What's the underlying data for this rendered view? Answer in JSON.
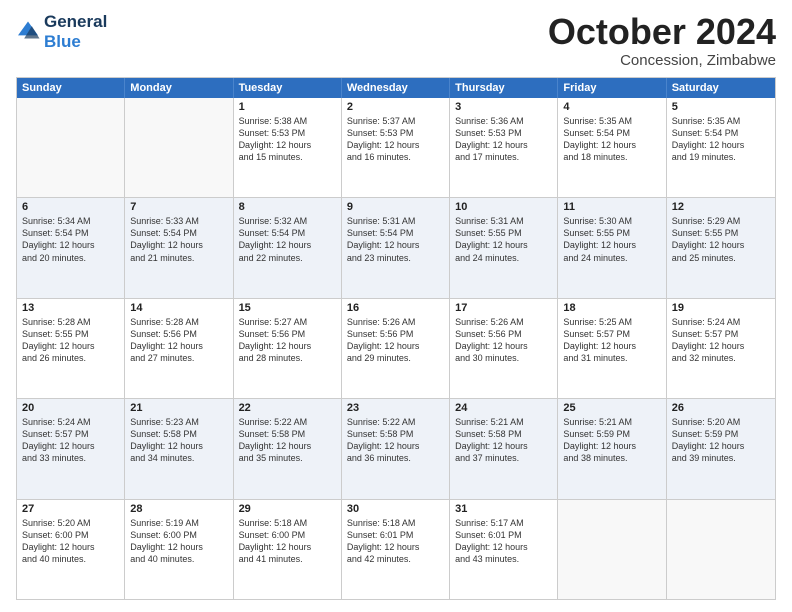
{
  "header": {
    "logo_line1": "General",
    "logo_line2": "Blue",
    "month": "October 2024",
    "location": "Concession, Zimbabwe"
  },
  "days": [
    "Sunday",
    "Monday",
    "Tuesday",
    "Wednesday",
    "Thursday",
    "Friday",
    "Saturday"
  ],
  "weeks": [
    [
      {
        "day": "",
        "lines": []
      },
      {
        "day": "",
        "lines": []
      },
      {
        "day": "1",
        "lines": [
          "Sunrise: 5:38 AM",
          "Sunset: 5:53 PM",
          "Daylight: 12 hours",
          "and 15 minutes."
        ]
      },
      {
        "day": "2",
        "lines": [
          "Sunrise: 5:37 AM",
          "Sunset: 5:53 PM",
          "Daylight: 12 hours",
          "and 16 minutes."
        ]
      },
      {
        "day": "3",
        "lines": [
          "Sunrise: 5:36 AM",
          "Sunset: 5:53 PM",
          "Daylight: 12 hours",
          "and 17 minutes."
        ]
      },
      {
        "day": "4",
        "lines": [
          "Sunrise: 5:35 AM",
          "Sunset: 5:54 PM",
          "Daylight: 12 hours",
          "and 18 minutes."
        ]
      },
      {
        "day": "5",
        "lines": [
          "Sunrise: 5:35 AM",
          "Sunset: 5:54 PM",
          "Daylight: 12 hours",
          "and 19 minutes."
        ]
      }
    ],
    [
      {
        "day": "6",
        "lines": [
          "Sunrise: 5:34 AM",
          "Sunset: 5:54 PM",
          "Daylight: 12 hours",
          "and 20 minutes."
        ]
      },
      {
        "day": "7",
        "lines": [
          "Sunrise: 5:33 AM",
          "Sunset: 5:54 PM",
          "Daylight: 12 hours",
          "and 21 minutes."
        ]
      },
      {
        "day": "8",
        "lines": [
          "Sunrise: 5:32 AM",
          "Sunset: 5:54 PM",
          "Daylight: 12 hours",
          "and 22 minutes."
        ]
      },
      {
        "day": "9",
        "lines": [
          "Sunrise: 5:31 AM",
          "Sunset: 5:54 PM",
          "Daylight: 12 hours",
          "and 23 minutes."
        ]
      },
      {
        "day": "10",
        "lines": [
          "Sunrise: 5:31 AM",
          "Sunset: 5:55 PM",
          "Daylight: 12 hours",
          "and 24 minutes."
        ]
      },
      {
        "day": "11",
        "lines": [
          "Sunrise: 5:30 AM",
          "Sunset: 5:55 PM",
          "Daylight: 12 hours",
          "and 24 minutes."
        ]
      },
      {
        "day": "12",
        "lines": [
          "Sunrise: 5:29 AM",
          "Sunset: 5:55 PM",
          "Daylight: 12 hours",
          "and 25 minutes."
        ]
      }
    ],
    [
      {
        "day": "13",
        "lines": [
          "Sunrise: 5:28 AM",
          "Sunset: 5:55 PM",
          "Daylight: 12 hours",
          "and 26 minutes."
        ]
      },
      {
        "day": "14",
        "lines": [
          "Sunrise: 5:28 AM",
          "Sunset: 5:56 PM",
          "Daylight: 12 hours",
          "and 27 minutes."
        ]
      },
      {
        "day": "15",
        "lines": [
          "Sunrise: 5:27 AM",
          "Sunset: 5:56 PM",
          "Daylight: 12 hours",
          "and 28 minutes."
        ]
      },
      {
        "day": "16",
        "lines": [
          "Sunrise: 5:26 AM",
          "Sunset: 5:56 PM",
          "Daylight: 12 hours",
          "and 29 minutes."
        ]
      },
      {
        "day": "17",
        "lines": [
          "Sunrise: 5:26 AM",
          "Sunset: 5:56 PM",
          "Daylight: 12 hours",
          "and 30 minutes."
        ]
      },
      {
        "day": "18",
        "lines": [
          "Sunrise: 5:25 AM",
          "Sunset: 5:57 PM",
          "Daylight: 12 hours",
          "and 31 minutes."
        ]
      },
      {
        "day": "19",
        "lines": [
          "Sunrise: 5:24 AM",
          "Sunset: 5:57 PM",
          "Daylight: 12 hours",
          "and 32 minutes."
        ]
      }
    ],
    [
      {
        "day": "20",
        "lines": [
          "Sunrise: 5:24 AM",
          "Sunset: 5:57 PM",
          "Daylight: 12 hours",
          "and 33 minutes."
        ]
      },
      {
        "day": "21",
        "lines": [
          "Sunrise: 5:23 AM",
          "Sunset: 5:58 PM",
          "Daylight: 12 hours",
          "and 34 minutes."
        ]
      },
      {
        "day": "22",
        "lines": [
          "Sunrise: 5:22 AM",
          "Sunset: 5:58 PM",
          "Daylight: 12 hours",
          "and 35 minutes."
        ]
      },
      {
        "day": "23",
        "lines": [
          "Sunrise: 5:22 AM",
          "Sunset: 5:58 PM",
          "Daylight: 12 hours",
          "and 36 minutes."
        ]
      },
      {
        "day": "24",
        "lines": [
          "Sunrise: 5:21 AM",
          "Sunset: 5:58 PM",
          "Daylight: 12 hours",
          "and 37 minutes."
        ]
      },
      {
        "day": "25",
        "lines": [
          "Sunrise: 5:21 AM",
          "Sunset: 5:59 PM",
          "Daylight: 12 hours",
          "and 38 minutes."
        ]
      },
      {
        "day": "26",
        "lines": [
          "Sunrise: 5:20 AM",
          "Sunset: 5:59 PM",
          "Daylight: 12 hours",
          "and 39 minutes."
        ]
      }
    ],
    [
      {
        "day": "27",
        "lines": [
          "Sunrise: 5:20 AM",
          "Sunset: 6:00 PM",
          "Daylight: 12 hours",
          "and 40 minutes."
        ]
      },
      {
        "day": "28",
        "lines": [
          "Sunrise: 5:19 AM",
          "Sunset: 6:00 PM",
          "Daylight: 12 hours",
          "and 40 minutes."
        ]
      },
      {
        "day": "29",
        "lines": [
          "Sunrise: 5:18 AM",
          "Sunset: 6:00 PM",
          "Daylight: 12 hours",
          "and 41 minutes."
        ]
      },
      {
        "day": "30",
        "lines": [
          "Sunrise: 5:18 AM",
          "Sunset: 6:01 PM",
          "Daylight: 12 hours",
          "and 42 minutes."
        ]
      },
      {
        "day": "31",
        "lines": [
          "Sunrise: 5:17 AM",
          "Sunset: 6:01 PM",
          "Daylight: 12 hours",
          "and 43 minutes."
        ]
      },
      {
        "day": "",
        "lines": []
      },
      {
        "day": "",
        "lines": []
      }
    ]
  ]
}
